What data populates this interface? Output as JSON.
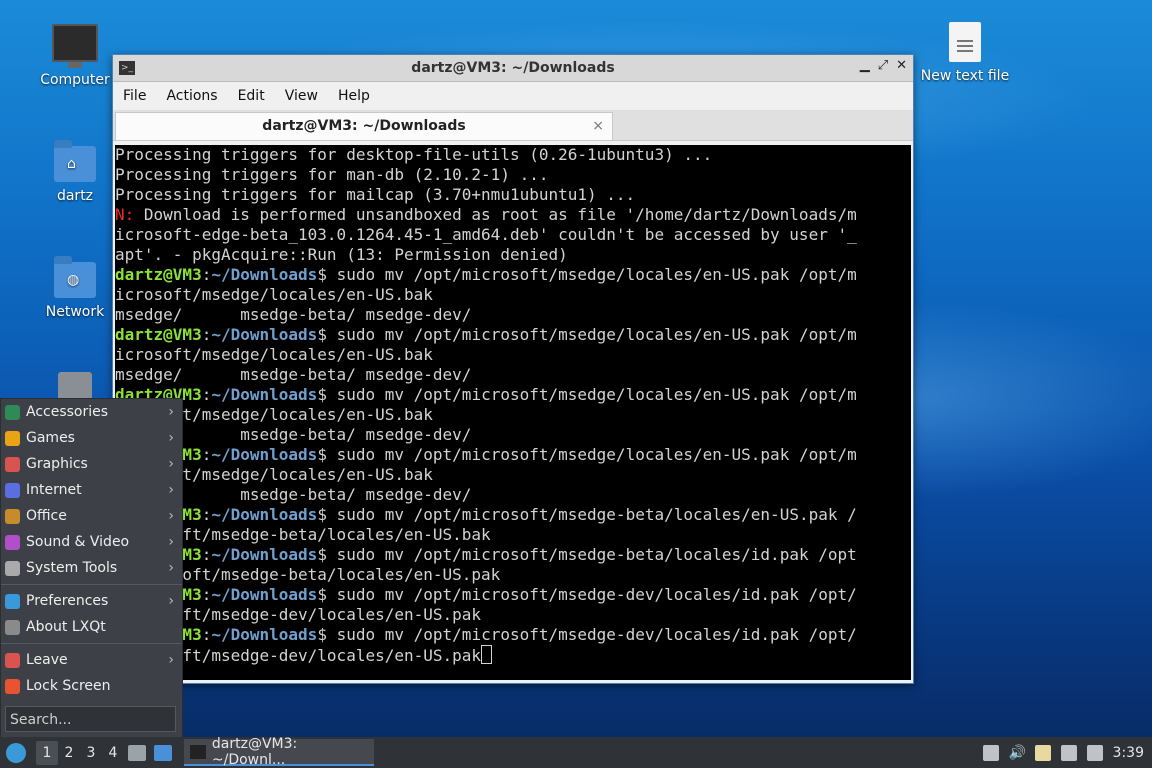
{
  "desktop": {
    "icons": [
      {
        "label": "Computer"
      },
      {
        "label": "dartz"
      },
      {
        "label": "Network"
      },
      {
        "label": ""
      },
      {
        "label": "New text file"
      }
    ]
  },
  "window": {
    "title": "dartz@VM3: ~/Downloads",
    "menu": [
      "File",
      "Actions",
      "Edit",
      "View",
      "Help"
    ],
    "tab_label": "dartz@VM3: ~/Downloads",
    "tab_close": "×"
  },
  "terminal": {
    "lines": [
      [
        {
          "t": "Processing triggers for desktop-file-utils (0.26-1ubuntu3) ..."
        }
      ],
      [
        {
          "t": "Processing triggers for man-db (2.10.2-1) ..."
        }
      ],
      [
        {
          "t": "Processing triggers for mailcap (3.70+nmu1ubuntu1) ..."
        }
      ],
      [
        {
          "t": "N:",
          "c": "r"
        },
        {
          "t": " Download is performed unsandboxed as root as file '/home/dartz/Downloads/m"
        }
      ],
      [
        {
          "t": "icrosoft-edge-beta_103.0.1264.45-1_amd64.deb' couldn't be accessed by user '_"
        }
      ],
      [
        {
          "t": "apt'. - pkgAcquire::Run (13: Permission denied)"
        }
      ],
      [
        {
          "t": "dartz@VM3",
          "c": "g"
        },
        {
          "t": ":"
        },
        {
          "t": "~/Downloads",
          "c": "b"
        },
        {
          "t": "$ sudo mv /opt/microsoft/msedge/locales/en-US.pak /opt/m"
        }
      ],
      [
        {
          "t": "icrosoft/msedge/locales/en-US.bak"
        }
      ],
      [
        {
          "t": "msedge/      msedge-beta/ msedge-dev/"
        }
      ],
      [
        {
          "t": "dartz@VM3",
          "c": "g"
        },
        {
          "t": ":"
        },
        {
          "t": "~/Downloads",
          "c": "b"
        },
        {
          "t": "$ sudo mv /opt/microsoft/msedge/locales/en-US.pak /opt/m"
        }
      ],
      [
        {
          "t": "icrosoft/msedge/locales/en-US.bak"
        }
      ],
      [
        {
          "t": "msedge/      msedge-beta/ msedge-dev/"
        }
      ],
      [
        {
          "t": "dartz@VM3",
          "c": "g"
        },
        {
          "t": ":"
        },
        {
          "t": "~/Downloads",
          "c": "b"
        },
        {
          "t": "$ sudo mv /opt/microsoft/msedge/locales/en-US.pak /opt/m"
        }
      ],
      [
        {
          "t": "icrosoft/msedge/locales/en-US.bak"
        }
      ],
      [
        {
          "t": "msedge/      msedge-beta/ msedge-dev/"
        }
      ],
      [
        {
          "t": "dartz@VM3",
          "c": "g"
        },
        {
          "t": ":"
        },
        {
          "t": "~/Downloads",
          "c": "b"
        },
        {
          "t": "$ sudo mv /opt/microsoft/msedge/locales/en-US.pak /opt/m"
        }
      ],
      [
        {
          "t": "icrosoft/msedge/locales/en-US.bak"
        }
      ],
      [
        {
          "t": "msedge/      msedge-beta/ msedge-dev/"
        }
      ],
      [
        {
          "t": "dartz@VM3",
          "c": "g"
        },
        {
          "t": ":"
        },
        {
          "t": "~/Downloads",
          "c": "b"
        },
        {
          "t": "$ sudo mv /opt/microsoft/msedge-beta/locales/en-US.pak /"
        }
      ],
      [
        {
          "t": "microsoft/msedge-beta/locales/en-US.bak"
        }
      ],
      [
        {
          "t": "dartz@VM3",
          "c": "g"
        },
        {
          "t": ":"
        },
        {
          "t": "~/Downloads",
          "c": "b"
        },
        {
          "t": "$ sudo mv /opt/microsoft/msedge-beta/locales/id.pak /opt"
        }
      ],
      [
        {
          "t": "/microsoft/msedge-beta/locales/en-US.pak"
        }
      ],
      [
        {
          "t": "dartz@VM3",
          "c": "g"
        },
        {
          "t": ":"
        },
        {
          "t": "~/Downloads",
          "c": "b"
        },
        {
          "t": "$ sudo mv /opt/microsoft/msedge-dev/locales/id.pak /opt/"
        }
      ],
      [
        {
          "t": "microsoft/msedge-dev/locales/en-US.pak"
        }
      ],
      [
        {
          "t": "dartz@VM3",
          "c": "g"
        },
        {
          "t": ":"
        },
        {
          "t": "~/Downloads",
          "c": "b"
        },
        {
          "t": "$ sudo mv /opt/microsoft/msedge-dev/locales/id.pak /opt/"
        }
      ],
      [
        {
          "t": "microsoft/msedge-dev/locales/en-US.pak"
        },
        {
          "cursor": true
        }
      ]
    ]
  },
  "start_menu": {
    "items": [
      {
        "label": "Accessories",
        "color": "#2e8b57",
        "arrow": true
      },
      {
        "label": "Games",
        "color": "#e8a317",
        "arrow": true
      },
      {
        "label": "Graphics",
        "color": "#d9534f",
        "arrow": true
      },
      {
        "label": "Internet",
        "color": "#5b6ee1",
        "arrow": true
      },
      {
        "label": "Office",
        "color": "#c58b2c",
        "arrow": true
      },
      {
        "label": "Sound & Video",
        "color": "#b04fc9",
        "arrow": true
      },
      {
        "label": "System Tools",
        "color": "#aaaaaa",
        "arrow": true
      },
      {
        "sep": true
      },
      {
        "label": "Preferences",
        "color": "#3a9ad9",
        "arrow": true
      },
      {
        "label": "About LXQt",
        "color": "#8a8a8a",
        "arrow": false
      },
      {
        "sep": true
      },
      {
        "label": "Leave",
        "color": "#d9534f",
        "arrow": true
      },
      {
        "label": "Lock Screen",
        "color": "#e8542f",
        "arrow": false
      }
    ],
    "arrow_glyph": "›",
    "search_placeholder": "Search..."
  },
  "taskbar": {
    "workspaces": [
      "1",
      "2",
      "3",
      "4"
    ],
    "active_workspace": "1",
    "task_label": "dartz@VM3: ~/Downl...",
    "clock": "3:39"
  }
}
